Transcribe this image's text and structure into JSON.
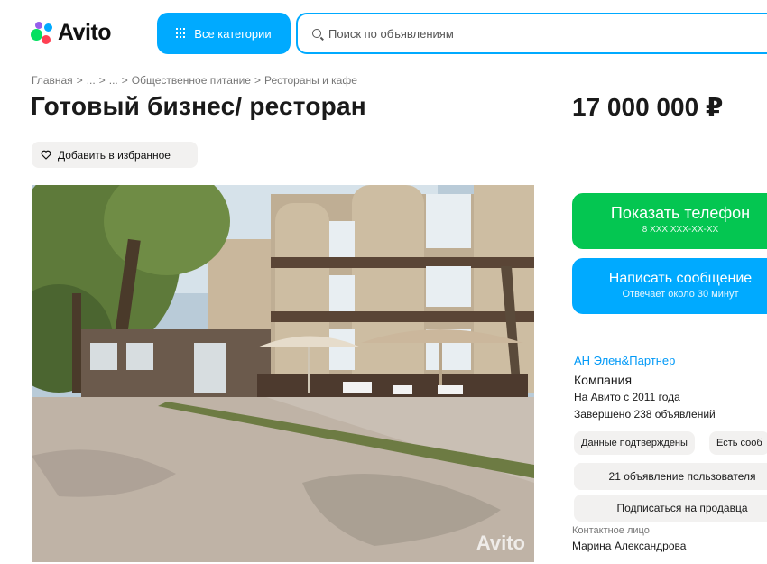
{
  "header": {
    "logo_text": "Avito",
    "categories_label": "Все категории",
    "search_placeholder": "Поиск по объявлениям"
  },
  "breadcrumb": [
    "Главная",
    ">",
    "...",
    ">",
    "...",
    ">",
    "Общественное питание",
    ">",
    "Рестораны и кафе"
  ],
  "listing": {
    "title": "Готовый бизнес/ ресторан",
    "price": "17 000 000 ₽",
    "favorite_label": "Добавить в избранное",
    "photo_watermark": "Avito"
  },
  "contact": {
    "phone_label": "Показать телефон",
    "phone_mask": "8 XXX XXX-XX-XX",
    "message_label": "Написать сообщение",
    "message_sub": "Отвечает около 30 минут"
  },
  "seller": {
    "name": "АН Элен&Партнер",
    "type": "Компания",
    "since": "На Авито с 2011 года",
    "completed": "Завершено 238 объявлений",
    "chip_verified": "Данные подтверждены",
    "chip_extra": "Есть сооб",
    "listings_button": "21 объявление пользователя",
    "subscribe_button": "Подписаться на продавца",
    "contact_label": "Контактное лицо",
    "contact_name": "Марина Александрова"
  },
  "colors": {
    "brand_blue": "#00aaff",
    "phone_green": "#04c651",
    "link_blue": "#0099f7"
  }
}
